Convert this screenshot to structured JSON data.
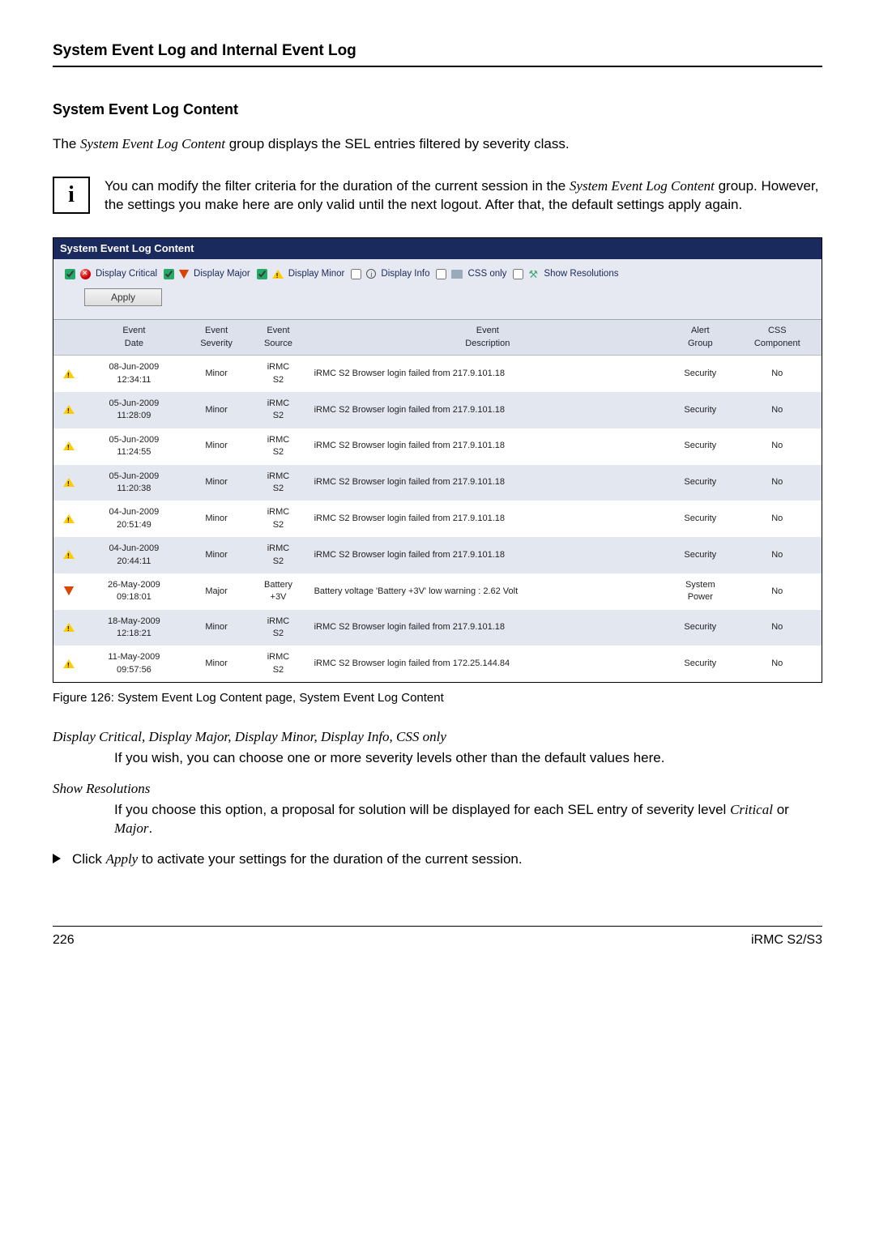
{
  "header": {
    "title": "System Event Log and Internal Event Log"
  },
  "section": {
    "heading": "System Event Log Content",
    "intro_pre": "The ",
    "intro_em": "System Event Log Content",
    "intro_post": " group displays the SEL entries filtered by severity class.",
    "info_pre": "You can modify the filter criteria for the duration of the current session in the ",
    "info_em": "System Event Log Content",
    "info_post": " group. However, the settings you make here are only valid until the next logout. After that, the default settings apply again."
  },
  "sel": {
    "title": "System Event Log Content",
    "filters": {
      "critical": "Display Critical",
      "major": "Display Major",
      "minor": "Display Minor",
      "info": "Display Info",
      "css": "CSS only",
      "res": "Show Resolutions",
      "apply": "Apply"
    },
    "columns": {
      "date": "Event\nDate",
      "severity": "Event\nSeverity",
      "source": "Event\nSource",
      "description": "Event\nDescription",
      "alert": "Alert\nGroup",
      "csscomp": "CSS\nComponent"
    },
    "rows": [
      {
        "icon": "minor",
        "date": "08-Jun-2009 12:34:11",
        "sev": "Minor",
        "src": "iRMC S2",
        "desc": "iRMC S2 Browser login failed from 217.9.101.18",
        "alert": "Security",
        "css": "No"
      },
      {
        "icon": "minor",
        "date": "05-Jun-2009 11:28:09",
        "sev": "Minor",
        "src": "iRMC S2",
        "desc": "iRMC S2 Browser login failed from 217.9.101.18",
        "alert": "Security",
        "css": "No"
      },
      {
        "icon": "minor",
        "date": "05-Jun-2009 11:24:55",
        "sev": "Minor",
        "src": "iRMC S2",
        "desc": "iRMC S2 Browser login failed from 217.9.101.18",
        "alert": "Security",
        "css": "No"
      },
      {
        "icon": "minor",
        "date": "05-Jun-2009 11:20:38",
        "sev": "Minor",
        "src": "iRMC S2",
        "desc": "iRMC S2 Browser login failed from 217.9.101.18",
        "alert": "Security",
        "css": "No"
      },
      {
        "icon": "minor",
        "date": "04-Jun-2009 20:51:49",
        "sev": "Minor",
        "src": "iRMC S2",
        "desc": "iRMC S2 Browser login failed from 217.9.101.18",
        "alert": "Security",
        "css": "No"
      },
      {
        "icon": "minor",
        "date": "04-Jun-2009 20:44:11",
        "sev": "Minor",
        "src": "iRMC S2",
        "desc": "iRMC S2 Browser login failed from 217.9.101.18",
        "alert": "Security",
        "css": "No"
      },
      {
        "icon": "major",
        "date": "26-May-2009 09:18:01",
        "sev": "Major",
        "src": "Battery +3V",
        "desc": "Battery voltage 'Battery +3V' low warning : 2.62 Volt",
        "alert": "System Power",
        "css": "No"
      },
      {
        "icon": "minor",
        "date": "18-May-2009 12:18:21",
        "sev": "Minor",
        "src": "iRMC S2",
        "desc": "iRMC S2 Browser login failed from 217.9.101.18",
        "alert": "Security",
        "css": "No"
      },
      {
        "icon": "minor",
        "date": "11-May-2009 09:57:56",
        "sev": "Minor",
        "src": "iRMC S2",
        "desc": "iRMC S2 Browser login failed from 172.25.144.84",
        "alert": "Security",
        "css": "No"
      }
    ]
  },
  "figure_caption": "Figure 126: System Event Log Content page, System Event Log Content",
  "defs": {
    "term1": "Display Critical, Display Major, Display Minor, Display Info, CSS only",
    "body1": "If you wish, you can choose one or more severity levels other than the default values here.",
    "term2": "Show Resolutions",
    "body2_pre": "If you choose this option, a proposal for solution will be displayed for each SEL entry of severity level ",
    "body2_em1": "Critical",
    "body2_mid": " or ",
    "body2_em2": "Major",
    "body2_post": "."
  },
  "bullet": {
    "pre": "Click ",
    "em": "Apply",
    "post": " to activate your settings for the duration of the current session."
  },
  "footer": {
    "page": "226",
    "product": "iRMC S2/S3"
  }
}
